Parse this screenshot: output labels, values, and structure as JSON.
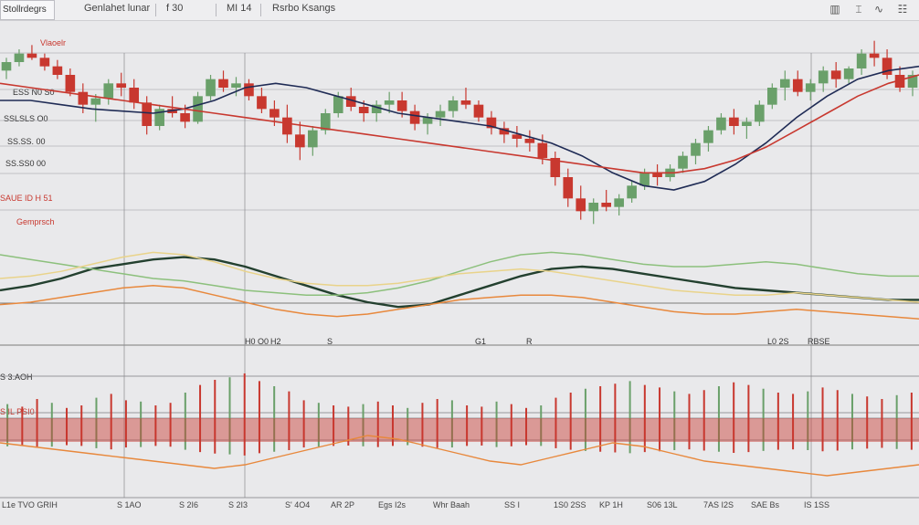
{
  "toolbar": {
    "tab_label": "Stollrdegrs",
    "item1": "Genlahet lunar",
    "item2": "f 30",
    "item3": "MI 14",
    "item4": "Rsrbo Ksangs",
    "icons": [
      "bar-chart-icon",
      "candles-icon",
      "pulse-icon",
      "settings-icon"
    ]
  },
  "labels": {
    "price_series": "Vlaoelr",
    "price_levels": [
      "ESS N0 S0",
      "SSLSLS O0",
      "SS.SS. 00",
      "SS.SS0 00",
      "SAUE ID H 51"
    ],
    "oscillator_title": "Gemprsch",
    "volume_value": "S 3.AOH",
    "volume_sub": "S IL PSI0",
    "top_axis_ticks": [
      "H0 O0",
      "H2",
      "S",
      "G1",
      "R",
      "L0 2S",
      "RBSE"
    ],
    "bottom_axis_ticks": [
      "L1e  TVO  GRIH",
      "S 1AO",
      "S 2I6",
      "S 2I3",
      "S' 4O4",
      "AR 2P",
      "Egs  I2s",
      "Whr  Baah",
      "SS I",
      "1S0  2SS",
      "KP 1H",
      "S06  13L",
      "7AS  I2S",
      "SAE  Bs",
      "IS 1SS"
    ]
  },
  "colors": {
    "up": "#6aa06a",
    "down": "#c8382f",
    "navy": "#1f2b55",
    "darkgreen": "#23402f",
    "lightgreen": "#8cc07c",
    "orange": "#e8883c",
    "yellow": "#e9d38a",
    "red": "#c8382f",
    "grid": "#8a8a8e"
  },
  "chart_data": {
    "type": "candlestick",
    "candles": [
      [
        74,
        80,
        70,
        78
      ],
      [
        78,
        84,
        76,
        82
      ],
      [
        82,
        86,
        79,
        80
      ],
      [
        80,
        82,
        74,
        76
      ],
      [
        76,
        79,
        70,
        72
      ],
      [
        72,
        75,
        62,
        64
      ],
      [
        64,
        68,
        54,
        58
      ],
      [
        58,
        63,
        50,
        61
      ],
      [
        61,
        70,
        58,
        68
      ],
      [
        68,
        73,
        62,
        66
      ],
      [
        66,
        70,
        56,
        59
      ],
      [
        59,
        62,
        44,
        48
      ],
      [
        48,
        58,
        46,
        56
      ],
      [
        56,
        62,
        52,
        54
      ],
      [
        54,
        58,
        47,
        50
      ],
      [
        50,
        64,
        49,
        62
      ],
      [
        62,
        72,
        60,
        70
      ],
      [
        70,
        74,
        64,
        66
      ],
      [
        66,
        71,
        62,
        68
      ],
      [
        68,
        70,
        60,
        62
      ],
      [
        62,
        66,
        54,
        56
      ],
      [
        56,
        60,
        48,
        52
      ],
      [
        52,
        58,
        40,
        44
      ],
      [
        44,
        50,
        32,
        38
      ],
      [
        38,
        48,
        34,
        46
      ],
      [
        46,
        56,
        44,
        54
      ],
      [
        54,
        64,
        52,
        62
      ],
      [
        62,
        66,
        55,
        57
      ],
      [
        57,
        60,
        50,
        54
      ],
      [
        54,
        60,
        50,
        58
      ],
      [
        58,
        64,
        54,
        60
      ],
      [
        60,
        64,
        52,
        55
      ],
      [
        55,
        58,
        46,
        49
      ],
      [
        49,
        54,
        44,
        52
      ],
      [
        52,
        58,
        48,
        55
      ],
      [
        55,
        62,
        52,
        60
      ],
      [
        60,
        66,
        56,
        58
      ],
      [
        58,
        60,
        50,
        52
      ],
      [
        52,
        55,
        44,
        47
      ],
      [
        47,
        50,
        40,
        44
      ],
      [
        44,
        48,
        38,
        42
      ],
      [
        42,
        46,
        36,
        40
      ],
      [
        40,
        44,
        30,
        33
      ],
      [
        33,
        36,
        20,
        24
      ],
      [
        24,
        28,
        10,
        14
      ],
      [
        14,
        20,
        4,
        8
      ],
      [
        8,
        14,
        2,
        12
      ],
      [
        12,
        18,
        8,
        10
      ],
      [
        10,
        16,
        6,
        14
      ],
      [
        14,
        22,
        12,
        20
      ],
      [
        20,
        28,
        18,
        26
      ],
      [
        26,
        30,
        20,
        24
      ],
      [
        24,
        30,
        22,
        28
      ],
      [
        28,
        36,
        26,
        34
      ],
      [
        34,
        42,
        30,
        40
      ],
      [
        40,
        48,
        36,
        46
      ],
      [
        46,
        54,
        44,
        52
      ],
      [
        52,
        56,
        44,
        48
      ],
      [
        48,
        52,
        42,
        50
      ],
      [
        50,
        60,
        48,
        58
      ],
      [
        58,
        68,
        56,
        66
      ],
      [
        66,
        74,
        60,
        70
      ],
      [
        70,
        74,
        62,
        64
      ],
      [
        64,
        70,
        60,
        68
      ],
      [
        68,
        76,
        64,
        74
      ],
      [
        74,
        78,
        66,
        70
      ],
      [
        70,
        76,
        68,
        75
      ],
      [
        75,
        84,
        72,
        82
      ],
      [
        82,
        88,
        76,
        80
      ],
      [
        80,
        84,
        70,
        72
      ],
      [
        72,
        76,
        64,
        66
      ],
      [
        66,
        74,
        62,
        72
      ]
    ],
    "indicator_lines": [
      {
        "color": "navy",
        "values": [
          60,
          60,
          58,
          56,
          55,
          54,
          56,
          60,
          66,
          68,
          66,
          62,
          58,
          54,
          52,
          50,
          48,
          44,
          40,
          34,
          26,
          20,
          18,
          22,
          30,
          40,
          52,
          62,
          70,
          74,
          76
        ]
      },
      {
        "color": "red",
        "values": [
          68,
          66,
          64,
          62,
          60,
          58,
          56,
          54,
          52,
          50,
          48,
          46,
          44,
          42,
          40,
          38,
          36,
          34,
          32,
          30,
          28,
          26,
          26,
          28,
          32,
          38,
          46,
          54,
          62,
          68,
          72
        ]
      }
    ],
    "oscillator_lines": [
      {
        "color": "darkgreen",
        "values": [
          40,
          44,
          50,
          58,
          62,
          66,
          68,
          66,
          60,
          52,
          44,
          36,
          30,
          26,
          28,
          36,
          44,
          52,
          58,
          60,
          58,
          54,
          50,
          46,
          42,
          40,
          38,
          36,
          34,
          32,
          32
        ]
      },
      {
        "color": "lightgreen",
        "values": [
          70,
          66,
          62,
          58,
          54,
          50,
          48,
          44,
          40,
          38,
          36,
          36,
          38,
          42,
          48,
          56,
          64,
          70,
          72,
          70,
          66,
          62,
          60,
          60,
          62,
          64,
          62,
          58,
          54,
          52,
          52
        ]
      },
      {
        "color": "orange",
        "values": [
          28,
          30,
          34,
          38,
          42,
          44,
          42,
          36,
          30,
          24,
          20,
          18,
          20,
          24,
          28,
          32,
          34,
          36,
          36,
          34,
          30,
          26,
          22,
          20,
          20,
          22,
          24,
          22,
          20,
          18,
          16
        ]
      },
      {
        "color": "yellow",
        "values": [
          50,
          52,
          56,
          62,
          68,
          72,
          70,
          64,
          56,
          50,
          46,
          44,
          44,
          46,
          50,
          54,
          56,
          58,
          56,
          52,
          48,
          44,
          40,
          38,
          36,
          36,
          38,
          36,
          34,
          32,
          30
        ]
      }
    ],
    "volume_values": [
      42,
      38,
      50,
      44,
      36,
      40,
      52,
      58,
      48,
      46,
      40,
      44,
      60,
      72,
      80,
      84,
      90,
      78,
      70,
      62,
      48,
      44,
      40,
      38,
      42,
      46,
      40,
      36,
      44,
      50,
      48,
      40,
      38,
      46,
      42,
      36,
      40,
      52,
      60,
      66,
      70,
      74,
      78,
      72,
      68,
      62,
      58,
      64,
      70,
      76,
      72,
      66,
      60,
      58,
      62,
      68,
      64,
      58,
      54,
      50,
      56,
      60
    ],
    "volume_line": [
      30,
      28,
      26,
      24,
      22,
      20,
      18,
      16,
      18,
      22,
      26,
      30,
      34,
      32,
      28,
      24,
      20,
      18,
      22,
      26,
      30,
      28,
      24,
      20,
      18,
      16,
      14,
      12,
      14,
      16,
      18
    ]
  }
}
